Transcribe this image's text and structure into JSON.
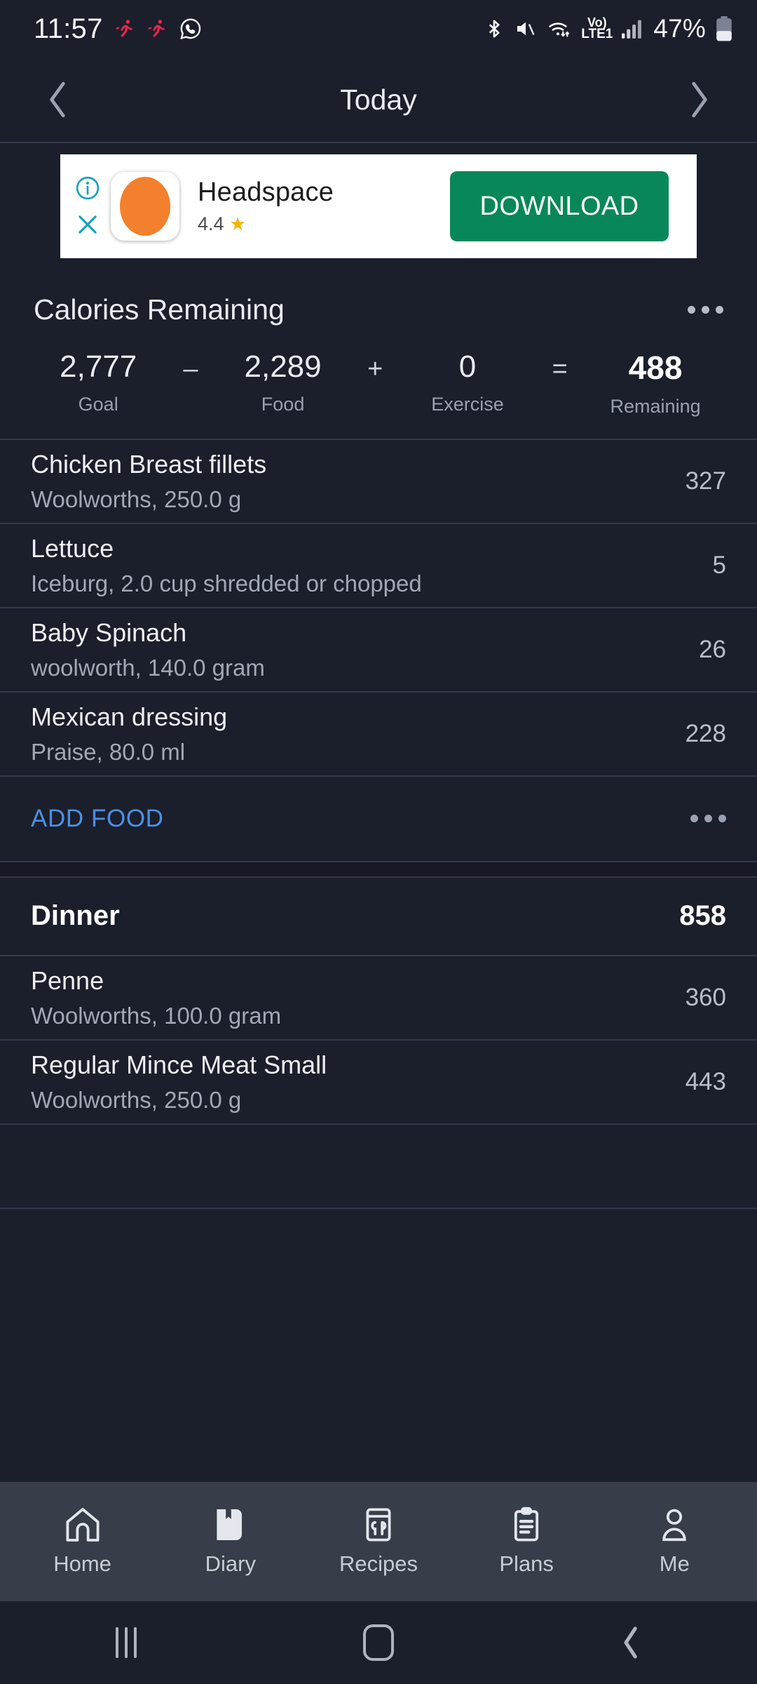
{
  "statusbar": {
    "time": "11:57",
    "left_icons": [
      "run-icon",
      "run-icon",
      "whatsapp-icon"
    ],
    "right_icons": [
      "bluetooth-icon",
      "mute-icon",
      "wifi-icon"
    ],
    "volte_line1": "Vo)",
    "volte_line2": "LTE1",
    "battery_percent": "47%"
  },
  "appbar": {
    "title": "Today",
    "prev_icon": "chevron-left-icon",
    "next_icon": "chevron-right-icon"
  },
  "ad": {
    "info_icon": "info-circle-icon",
    "close_icon": "close-x-icon",
    "app_icon": "headspace-app-icon",
    "title": "Headspace",
    "rating": "4.4",
    "star_icon": "star-icon",
    "cta_label": "DOWNLOAD",
    "cta_color": "#08875a",
    "badge_color": "#17a2b8",
    "app_icon_color": "#f2802c"
  },
  "calories": {
    "title": "Calories Remaining",
    "overflow_icon": "more-horizontal-icon",
    "goal_value": "2,777",
    "goal_label": "Goal",
    "op_minus": "–",
    "food_value": "2,289",
    "food_label": "Food",
    "op_plus": "+",
    "exercise_value": "0",
    "exercise_label": "Exercise",
    "op_equals": "=",
    "remaining_value": "488",
    "remaining_label": "Remaining"
  },
  "lunch_entries": [
    {
      "name": "Chicken Breast fillets",
      "detail": "Woolworths, 250.0 g",
      "calories": "327"
    },
    {
      "name": "Lettuce",
      "detail": "Iceburg, 2.0 cup shredded or chopped",
      "calories": "5"
    },
    {
      "name": "Baby Spinach",
      "detail": "woolworth, 140.0 gram",
      "calories": "26"
    },
    {
      "name": "Mexican dressing",
      "detail": "Praise, 80.0 ml",
      "calories": "228"
    }
  ],
  "add_food": {
    "label": "ADD FOOD",
    "color": "#4a90e2",
    "overflow_icon": "more-horizontal-icon"
  },
  "dinner": {
    "name": "Dinner",
    "calories": "858"
  },
  "dinner_entries": [
    {
      "name": "Penne",
      "detail": "Woolworths, 100.0 gram",
      "calories": "360"
    },
    {
      "name": "Regular Mince Meat Small",
      "detail": "Woolworths, 250.0 g",
      "calories": "443"
    }
  ],
  "tabbar": {
    "items": [
      {
        "label": "Home",
        "icon": "home-icon"
      },
      {
        "label": "Diary",
        "icon": "book-bookmark-icon"
      },
      {
        "label": "Recipes",
        "icon": "recipes-icon"
      },
      {
        "label": "Plans",
        "icon": "clipboard-icon"
      },
      {
        "label": "Me",
        "icon": "person-icon"
      }
    ]
  },
  "navbar": {
    "recents_icon": "recents-icon",
    "home_icon": "home-square-icon",
    "back_icon": "back-chevron-icon"
  }
}
